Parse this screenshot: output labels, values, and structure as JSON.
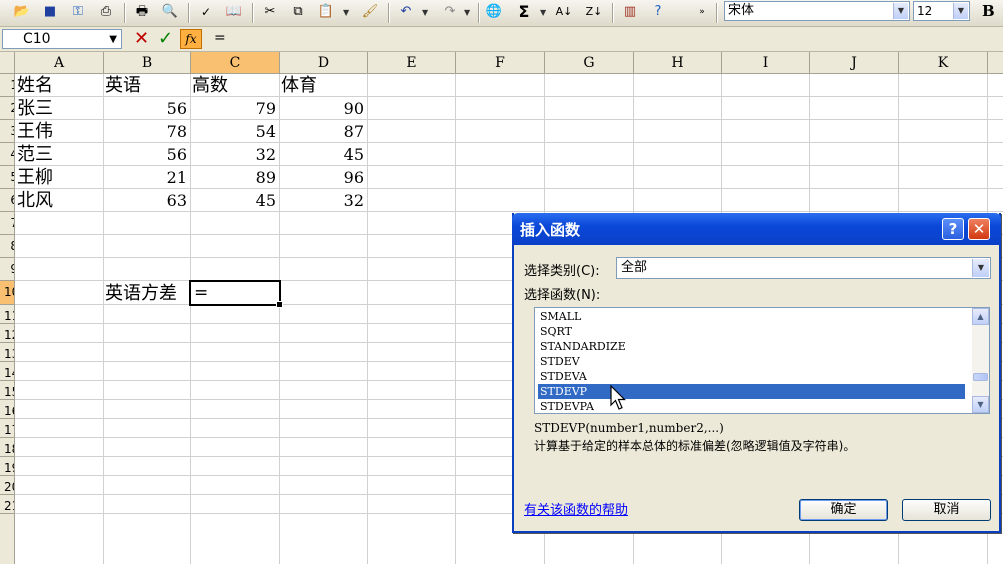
{
  "toolbar": {
    "font_name": "宋体",
    "font_size": "12",
    "bold_label": "B",
    "sigma_label": "Σ"
  },
  "formula_bar": {
    "name_box": "C10",
    "fx_label": "fx",
    "formula": "="
  },
  "columns": [
    "A",
    "B",
    "C",
    "D",
    "E",
    "F",
    "G",
    "H",
    "I",
    "J",
    "K"
  ],
  "rows": [
    "1",
    "2",
    "3",
    "4",
    "5",
    "6",
    "7",
    "8",
    "9",
    "10",
    "11",
    "12",
    "13",
    "14",
    "15",
    "16",
    "17",
    "18",
    "19",
    "20",
    "21"
  ],
  "sheet": {
    "header_row": [
      "姓名",
      "英语",
      "高数",
      "体育"
    ],
    "data_rows": [
      {
        "name": "张三",
        "english": "56",
        "math": "79",
        "pe": "90"
      },
      {
        "name": "王伟",
        "english": "78",
        "math": "54",
        "pe": "87"
      },
      {
        "name": "范三",
        "english": "56",
        "math": "32",
        "pe": "45"
      },
      {
        "name": "王柳",
        "english": "21",
        "math": "89",
        "pe": "96"
      },
      {
        "name": "北风",
        "english": "63",
        "math": "45",
        "pe": "32"
      }
    ],
    "variance_label": "英语方差",
    "active_cell_value": "="
  },
  "dialog": {
    "title": "插入函数",
    "help_button": "?",
    "close_button": "✕",
    "category_label": "选择类别(C):",
    "category_value": "全部",
    "function_label": "选择函数(N):",
    "functions": [
      "SMALL",
      "SQRT",
      "STANDARDIZE",
      "STDEV",
      "STDEVA",
      "STDEVP",
      "STDEVPA"
    ],
    "selected_function": "STDEVP",
    "syntax": "STDEVP(number1,number2,...)",
    "description": "计算基于给定的样本总体的标准偏差(忽略逻辑值及字符串)。",
    "help_link": "有关该函数的帮助",
    "ok_label": "确定",
    "cancel_label": "取消"
  }
}
